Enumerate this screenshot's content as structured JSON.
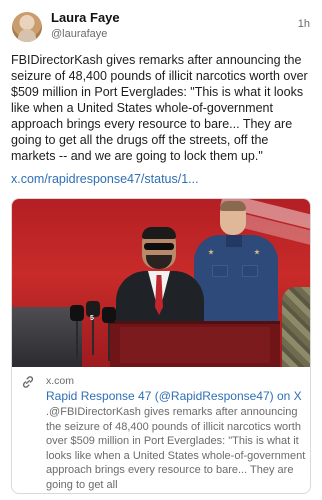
{
  "author": {
    "display_name": "Laura Faye",
    "handle": "@laurafaye",
    "avatar_icon": "avatar-icon"
  },
  "timestamp": "1h",
  "post_text": "FBIDirectorKash gives remarks after announcing the seizure of 48,400 pounds of illicit narcotics worth over $509 million in Port Everglades: \"This is what it looks like when a United States whole-of-government approach brings every resource to bare... They are going to get all the drugs off the streets, off the markets -- and we are going to lock them up.\"",
  "post_link": "x.com/rapidresponse47/status/1...",
  "link_card": {
    "domain": "x.com",
    "title": "Rapid Response 47 (@RapidResponse47) on X",
    "description": ".@FBIDirectorKash gives remarks after announcing the seizure of 48,400 pounds of illicit narcotics worth over $509 million in Port Everglades: \"This is what it looks like when a United States whole-of-government approach brings every resource to bare... They are going to get all",
    "image_mic_tag": "5",
    "link_icon": "link-icon"
  },
  "colors": {
    "link": "#2f6fb5",
    "secondary_text": "#6b6b6b",
    "card_border": "#d9d9d9"
  }
}
